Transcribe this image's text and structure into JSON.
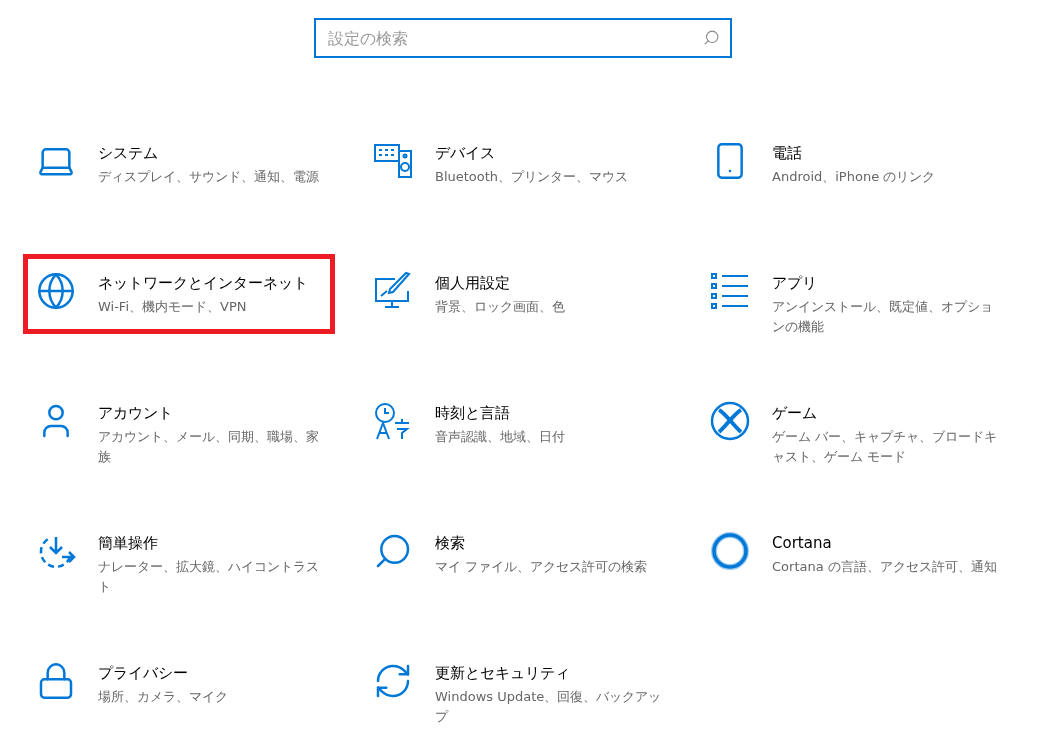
{
  "search": {
    "placeholder": "設定の検索"
  },
  "categories": [
    {
      "kind": "system",
      "title": "システム",
      "description": "ディスプレイ、サウンド、通知、電源",
      "highlighted": false
    },
    {
      "kind": "devices",
      "title": "デバイス",
      "description": "Bluetooth、プリンター、マウス",
      "highlighted": false
    },
    {
      "kind": "phone",
      "title": "電話",
      "description": "Android、iPhone のリンク",
      "highlighted": false
    },
    {
      "kind": "network",
      "title": "ネットワークとインターネット",
      "description": "Wi-Fi、機内モード、VPN",
      "highlighted": true
    },
    {
      "kind": "personalization",
      "title": "個人用設定",
      "description": "背景、ロック画面、色",
      "highlighted": false
    },
    {
      "kind": "apps",
      "title": "アプリ",
      "description": "アンインストール、既定値、オプションの機能",
      "highlighted": false
    },
    {
      "kind": "accounts",
      "title": "アカウント",
      "description": "アカウント、メール、同期、職場、家族",
      "highlighted": false
    },
    {
      "kind": "time",
      "title": "時刻と言語",
      "description": "音声認識、地域、日付",
      "highlighted": false
    },
    {
      "kind": "gaming",
      "title": "ゲーム",
      "description": "ゲーム バー、キャプチャ、ブロードキャスト、ゲーム モード",
      "highlighted": false
    },
    {
      "kind": "ease",
      "title": "簡単操作",
      "description": "ナレーター、拡大鏡、ハイコントラスト",
      "highlighted": false
    },
    {
      "kind": "search",
      "title": "検索",
      "description": "マイ ファイル、アクセス許可の検索",
      "highlighted": false
    },
    {
      "kind": "cortana",
      "title": "Cortana",
      "description": "Cortana の言語、アクセス許可、通知",
      "highlighted": false
    },
    {
      "kind": "privacy",
      "title": "プライバシー",
      "description": "場所、カメラ、マイク",
      "highlighted": false
    },
    {
      "kind": "update",
      "title": "更新とセキュリティ",
      "description": "Windows Update、回復、バックアップ",
      "highlighted": false
    }
  ]
}
